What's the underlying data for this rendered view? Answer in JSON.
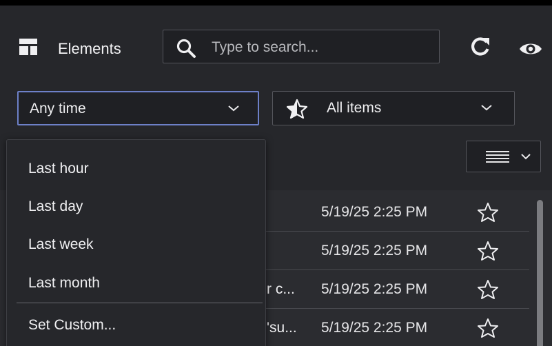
{
  "header": {
    "title": "Elements",
    "icon": "elements-icon",
    "search": {
      "placeholder": "Type to search...",
      "value": ""
    },
    "actions": [
      "refresh-icon",
      "eye-icon"
    ]
  },
  "filters": {
    "time": {
      "selected": "Any time"
    },
    "items": {
      "selected": "All items",
      "icon": "star-filter-icon"
    }
  },
  "view_toggle": {
    "icon": "list-view-icon"
  },
  "time_menu": {
    "items": [
      "Last hour",
      "Last day",
      "Last week",
      "Last month"
    ],
    "custom": "Set Custom..."
  },
  "list": {
    "rows": [
      {
        "name_fragment": "",
        "date": "5/19/25 2:25 PM"
      },
      {
        "name_fragment": "",
        "date": "5/19/25 2:25 PM"
      },
      {
        "name_fragment": "r c...",
        "date": "5/19/25 2:25 PM"
      },
      {
        "name_fragment": "'su...",
        "date": "5/19/25 2:25 PM"
      }
    ]
  },
  "colors": {
    "panel": "#26272b",
    "focus_border": "#6d80c8",
    "text": "#e8e8ea"
  }
}
